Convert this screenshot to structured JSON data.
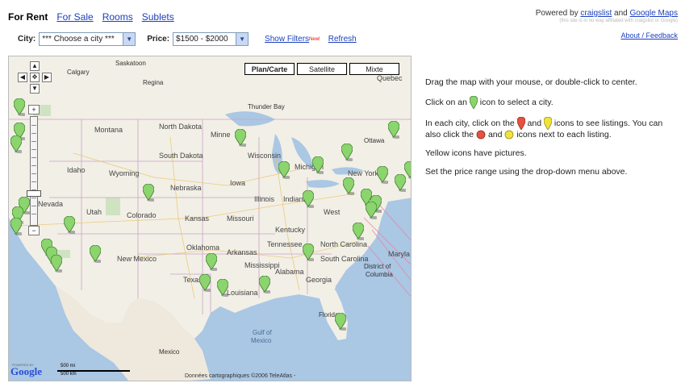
{
  "nav": {
    "for_rent": "For Rent",
    "for_sale": "For Sale",
    "rooms": "Rooms",
    "sublets": "Sublets"
  },
  "powered": {
    "prefix": "Powered by",
    "craigslist": "craigslist",
    "and": "and",
    "google_maps": "Google Maps",
    "disclaimer": "(this site is in no way affiliated with craigslist or Google)",
    "about": "About / Feedback"
  },
  "filters": {
    "city_label": "City:",
    "city_value": "*** Choose a city ***",
    "price_label": "Price:",
    "price_value": "$1500 - $2000",
    "show_filters": "Show Filters",
    "new_badge": "New!",
    "refresh": "Refresh"
  },
  "map": {
    "types": [
      "Plan/Carte",
      "Satellite",
      "Mixte"
    ],
    "selected_type": "Plan/Carte",
    "scale_mi": "500 mi",
    "scale_km": "500 km",
    "logo": "Google",
    "powered_by": "POWERED BY",
    "copyright": "Données cartographiques ©2006 TeleAtlas -",
    "labels": {
      "montana": "Montana",
      "north_dakota": "North Dakota",
      "south_dakota": "South Dakota",
      "idaho": "Idaho",
      "wyoming": "Wyoming",
      "nevada": "Nevada",
      "utah": "Utah",
      "colorado": "Colorado",
      "nebraska": "Nebraska",
      "kansas": "Kansas",
      "iowa": "Iowa",
      "missouri": "Missouri",
      "oklahoma": "Oklahoma",
      "arkansas": "Arkansas",
      "new_mexico": "New Mexico",
      "texas": "Texas",
      "mississippi": "Mississippi",
      "alabama": "Alabama",
      "georgia": "Georgia",
      "louisiana": "Louisiana",
      "tennessee": "Tennessee",
      "kentucky": "Kentucky",
      "north_carolina": "North Carolina",
      "south_carolina": "South Carolina",
      "wisconsin": "Wisconsin",
      "michigan": "Michigan",
      "illinois": "Illinois",
      "indiana": "Indiana",
      "west_virginia": "West",
      "minnesota": "Minne",
      "new_york": "New York",
      "quebec": "Quebec",
      "ottawa": "Ottawa",
      "calgary": "Calgary",
      "regina": "Regina",
      "saskatoon": "Saskatoon",
      "gulf_of_mexico": "Gulf of",
      "gulf_of_mexico_2": "Mexico",
      "mexico": "Mexico",
      "florida": "Florida",
      "thunder_bay": "Thunder Bay",
      "maryland": "Maryla",
      "district_of": "District of",
      "columbia": "Columbia"
    }
  },
  "instructions": {
    "p1": "Drag the map with your mouse, or double-click to center.",
    "p2_a": "Click on an",
    "p2_b": "icon to select a city.",
    "p3_a": "In each city, click on the",
    "p3_b": "and",
    "p3_c": "icons to see listings.",
    "p3_d": "You can also click the",
    "p3_e": "and",
    "p3_f": "icons next to each listing.",
    "p4": "Yellow icons have pictures.",
    "p5": "Set the price range using the drop-down menu above."
  },
  "colors": {
    "link": "#1a3fbf",
    "pin_green": "#8bd46e",
    "pin_red": "#e8513f",
    "pin_yellow": "#f2e33b"
  }
}
